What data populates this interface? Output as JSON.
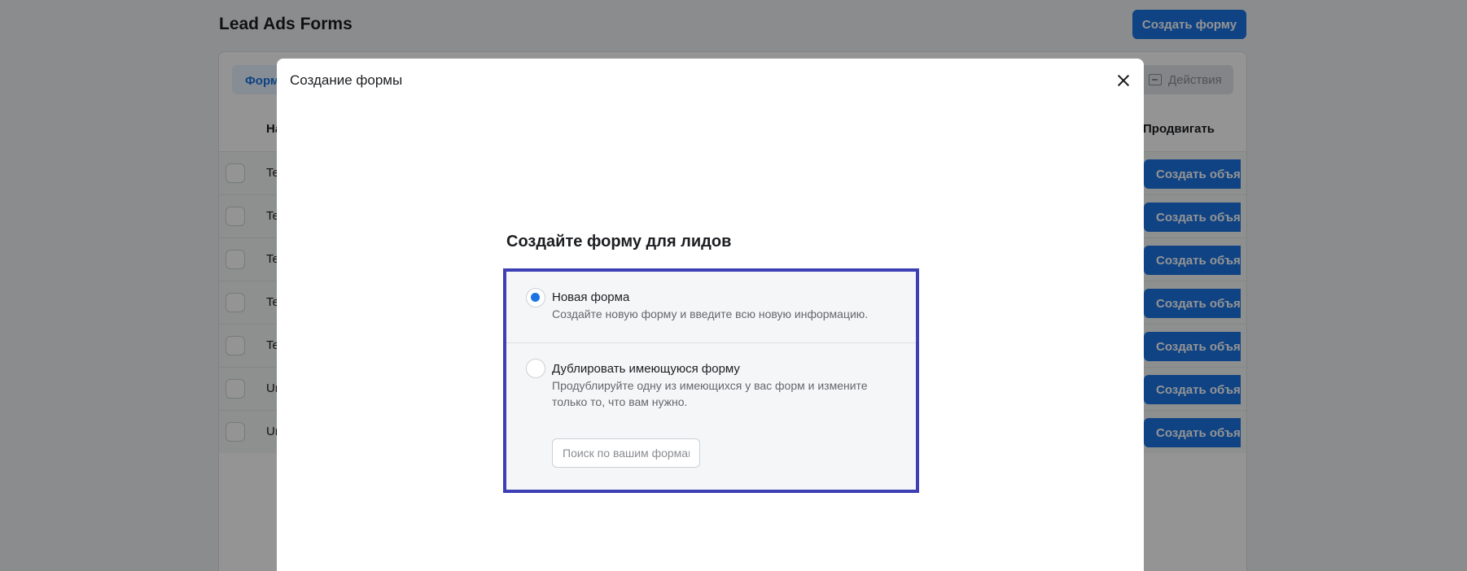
{
  "page": {
    "title": "Lead Ads Forms",
    "create_form_button": "Создать форму",
    "tab_forms": "Формы",
    "actions_button": "Действия",
    "actions_icon": "archive-icon",
    "columns": {
      "name": "На",
      "promote": "Продвигать"
    },
    "rows": [
      {
        "name": "Te",
        "button": "Создать объявление"
      },
      {
        "name": "Te",
        "button": "Создать объявление"
      },
      {
        "name": "Te",
        "button": "Создать объявление"
      },
      {
        "name": "Te",
        "button": "Создать объявление"
      },
      {
        "name": "Te",
        "button": "Создать объявление"
      },
      {
        "name": "Ur",
        "button": "Создать объявление"
      },
      {
        "name": "Ur",
        "button": "Создать объявление"
      }
    ]
  },
  "modal": {
    "title": "Создание формы",
    "close_icon": "close-icon",
    "section_title": "Создайте форму для лидов",
    "options": {
      "new": {
        "label": "Новая форма",
        "description": "Создайте новую форму и введите всю новую информацию.",
        "selected": true
      },
      "duplicate": {
        "label": "Дублировать имеющуюся форму",
        "description": "Продублируйте одну из имеющихся у вас форм и измените только то, что вам нужно.",
        "selected": false,
        "search_placeholder": "Поиск по вашим формам"
      }
    }
  },
  "colors": {
    "accent": "#1b74e4",
    "highlight_border": "#3d3fb5",
    "overlay": "rgba(0,0,0,0.42)"
  }
}
